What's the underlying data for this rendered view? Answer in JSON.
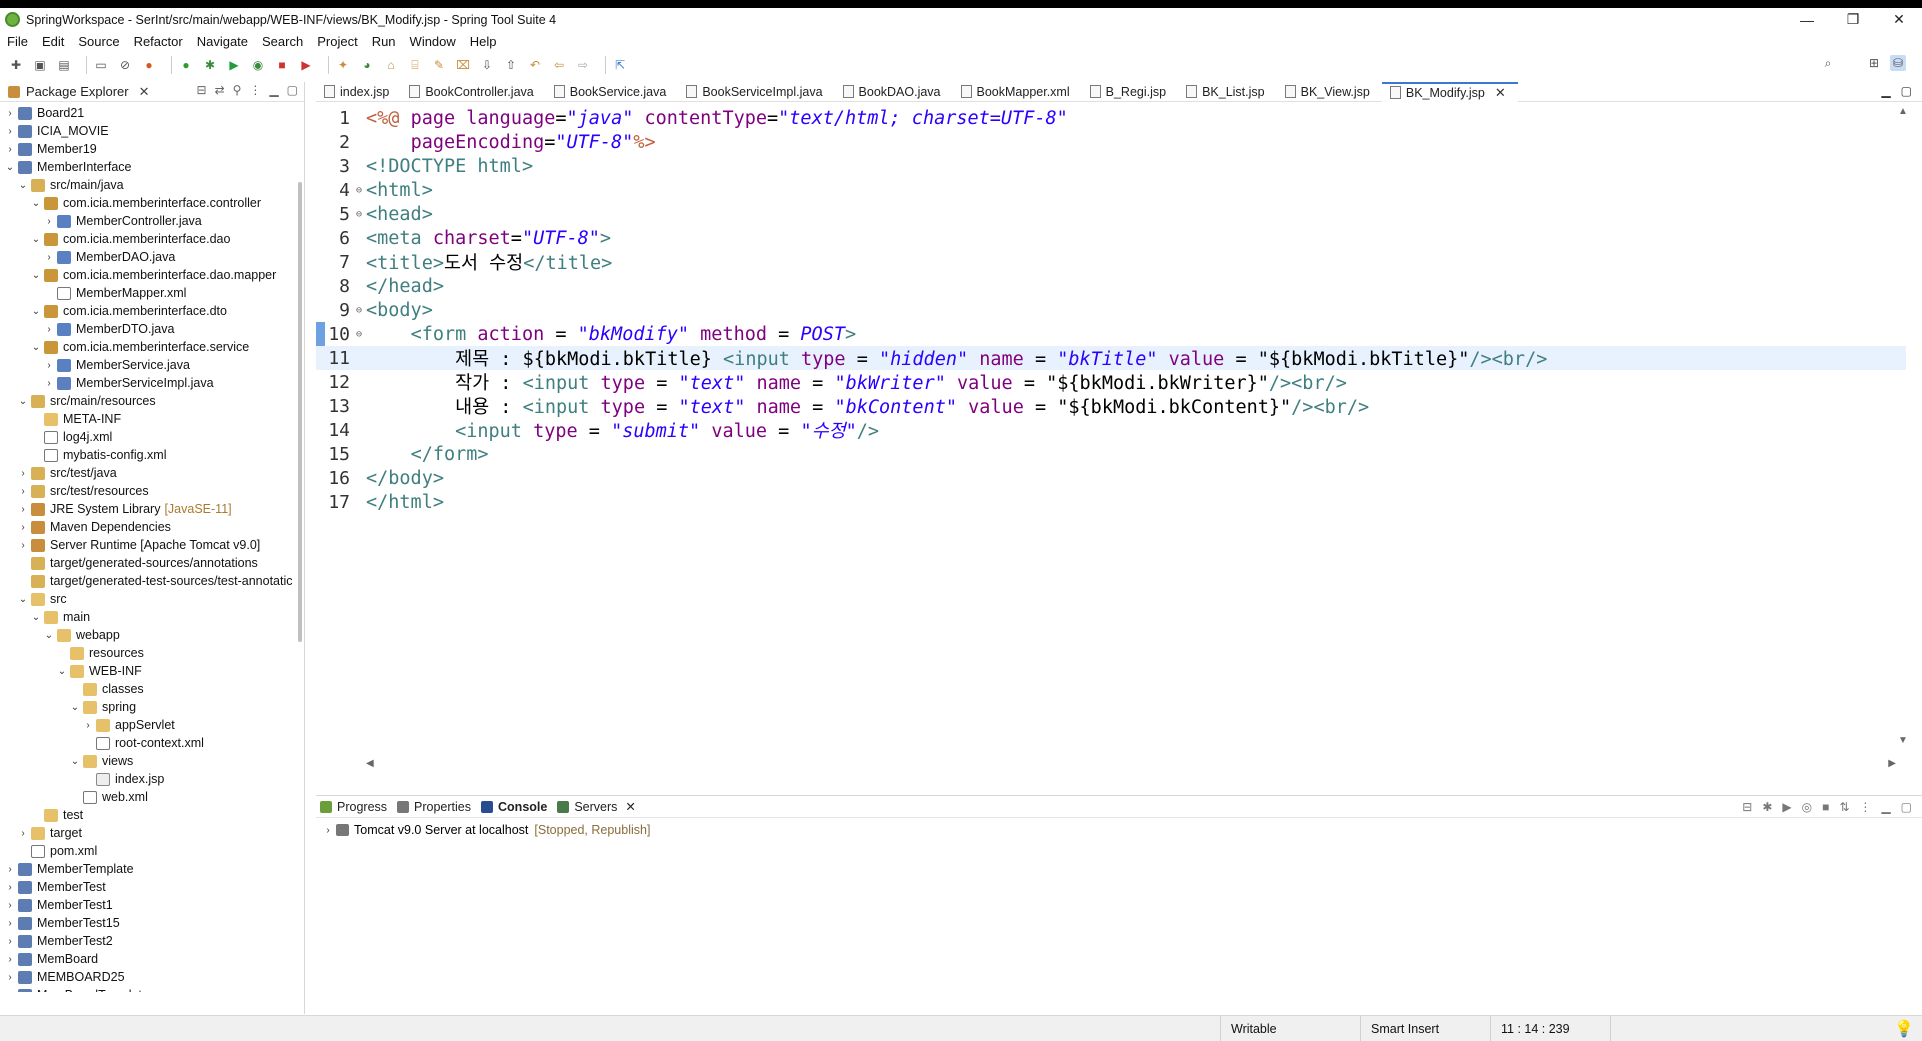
{
  "window": {
    "title": "SpringWorkspace - SerInt/src/main/webapp/WEB-INF/views/BK_Modify.jsp - Spring Tool Suite 4",
    "minimize": "—",
    "restore": "❐",
    "close": "✕"
  },
  "menu": [
    "File",
    "Edit",
    "Source",
    "Refactor",
    "Navigate",
    "Search",
    "Project",
    "Run",
    "Window",
    "Help"
  ],
  "package_explorer": {
    "title": "Package Explorer",
    "tree": [
      {
        "label": "Board21",
        "level": 0,
        "twisty": "›",
        "icon": "proj"
      },
      {
        "label": "ICIA_MOVIE",
        "level": 0,
        "twisty": "›",
        "icon": "proj"
      },
      {
        "label": "Member19",
        "level": 0,
        "twisty": "›",
        "icon": "proj"
      },
      {
        "label": "MemberInterface",
        "level": 0,
        "twisty": "⌄",
        "icon": "proj"
      },
      {
        "label": "src/main/java",
        "level": 1,
        "twisty": "⌄",
        "icon": "srcf"
      },
      {
        "label": "com.icia.memberinterface.controller",
        "level": 2,
        "twisty": "⌄",
        "icon": "pkg"
      },
      {
        "label": "MemberController.java",
        "level": 3,
        "twisty": "›",
        "icon": "java"
      },
      {
        "label": "com.icia.memberinterface.dao",
        "level": 2,
        "twisty": "⌄",
        "icon": "pkg"
      },
      {
        "label": "MemberDAO.java",
        "level": 3,
        "twisty": "›",
        "icon": "java"
      },
      {
        "label": "com.icia.memberinterface.dao.mapper",
        "level": 2,
        "twisty": "⌄",
        "icon": "pkg"
      },
      {
        "label": "MemberMapper.xml",
        "level": 3,
        "twisty": "",
        "icon": "xml"
      },
      {
        "label": "com.icia.memberinterface.dto",
        "level": 2,
        "twisty": "⌄",
        "icon": "pkg"
      },
      {
        "label": "MemberDTO.java",
        "level": 3,
        "twisty": "›",
        "icon": "java"
      },
      {
        "label": "com.icia.memberinterface.service",
        "level": 2,
        "twisty": "⌄",
        "icon": "pkg"
      },
      {
        "label": "MemberService.java",
        "level": 3,
        "twisty": "›",
        "icon": "java"
      },
      {
        "label": "MemberServiceImpl.java",
        "level": 3,
        "twisty": "›",
        "icon": "java"
      },
      {
        "label": "src/main/resources",
        "level": 1,
        "twisty": "⌄",
        "icon": "srcf"
      },
      {
        "label": "META-INF",
        "level": 2,
        "twisty": "",
        "icon": "folder"
      },
      {
        "label": "log4j.xml",
        "level": 2,
        "twisty": "",
        "icon": "xml"
      },
      {
        "label": "mybatis-config.xml",
        "level": 2,
        "twisty": "",
        "icon": "xml"
      },
      {
        "label": "src/test/java",
        "level": 1,
        "twisty": "›",
        "icon": "srcf"
      },
      {
        "label": "src/test/resources",
        "level": 1,
        "twisty": "›",
        "icon": "srcf"
      },
      {
        "label": "JRE System Library",
        "extra": "[JavaSE-11]",
        "level": 1,
        "twisty": "›",
        "icon": "lib"
      },
      {
        "label": "Maven Dependencies",
        "level": 1,
        "twisty": "›",
        "icon": "lib"
      },
      {
        "label": "Server Runtime [Apache Tomcat v9.0]",
        "level": 1,
        "twisty": "›",
        "icon": "lib"
      },
      {
        "label": "target/generated-sources/annotations",
        "level": 1,
        "twisty": "",
        "icon": "srcf"
      },
      {
        "label": "target/generated-test-sources/test-annotatic",
        "level": 1,
        "twisty": "",
        "icon": "srcf"
      },
      {
        "label": "src",
        "level": 1,
        "twisty": "⌄",
        "icon": "folder"
      },
      {
        "label": "main",
        "level": 2,
        "twisty": "⌄",
        "icon": "folder"
      },
      {
        "label": "webapp",
        "level": 3,
        "twisty": "⌄",
        "icon": "folder"
      },
      {
        "label": "resources",
        "level": 4,
        "twisty": "",
        "icon": "folder"
      },
      {
        "label": "WEB-INF",
        "level": 4,
        "twisty": "⌄",
        "icon": "folder"
      },
      {
        "label": "classes",
        "level": 5,
        "twisty": "",
        "icon": "folder"
      },
      {
        "label": "spring",
        "level": 5,
        "twisty": "⌄",
        "icon": "folder"
      },
      {
        "label": "appServlet",
        "level": 6,
        "twisty": "›",
        "icon": "folder"
      },
      {
        "label": "root-context.xml",
        "level": 6,
        "twisty": "",
        "icon": "xml"
      },
      {
        "label": "views",
        "level": 5,
        "twisty": "⌄",
        "icon": "folder"
      },
      {
        "label": "index.jsp",
        "level": 6,
        "twisty": "",
        "icon": "jsp"
      },
      {
        "label": "web.xml",
        "level": 5,
        "twisty": "",
        "icon": "xml"
      },
      {
        "label": "test",
        "level": 2,
        "twisty": "",
        "icon": "folder"
      },
      {
        "label": "target",
        "level": 1,
        "twisty": "›",
        "icon": "folder"
      },
      {
        "label": "pom.xml",
        "level": 1,
        "twisty": "",
        "icon": "xml"
      },
      {
        "label": "MemberTemplate",
        "level": 0,
        "twisty": "›",
        "icon": "proj"
      },
      {
        "label": "MemberTest",
        "level": 0,
        "twisty": "›",
        "icon": "proj"
      },
      {
        "label": "MemberTest1",
        "level": 0,
        "twisty": "›",
        "icon": "proj"
      },
      {
        "label": "MemberTest15",
        "level": 0,
        "twisty": "›",
        "icon": "proj"
      },
      {
        "label": "MemberTest2",
        "level": 0,
        "twisty": "›",
        "icon": "proj"
      },
      {
        "label": "MemBoard",
        "level": 0,
        "twisty": "›",
        "icon": "proj"
      },
      {
        "label": "MEMBOARD25",
        "level": 0,
        "twisty": "›",
        "icon": "proj"
      },
      {
        "label": "MemBoardTemplate",
        "level": 0,
        "twisty": "›",
        "icon": "proj"
      }
    ]
  },
  "editor": {
    "tabs": [
      {
        "label": "index.jsp",
        "active": false
      },
      {
        "label": "BookController.java",
        "active": false
      },
      {
        "label": "BookService.java",
        "active": false
      },
      {
        "label": "BookServiceImpl.java",
        "active": false
      },
      {
        "label": "BookDAO.java",
        "active": false
      },
      {
        "label": "BookMapper.xml",
        "active": false
      },
      {
        "label": "B_Regi.jsp",
        "active": false
      },
      {
        "label": "BK_List.jsp",
        "active": false
      },
      {
        "label": "BK_View.jsp",
        "active": false
      },
      {
        "label": "BK_Modify.jsp",
        "active": true
      }
    ],
    "current_line": 11,
    "lines": [
      {
        "n": "1",
        "fold": "",
        "tokens": [
          [
            "dir",
            "<%@ "
          ],
          [
            "attr",
            "page "
          ],
          [
            "attr",
            "language"
          ],
          [
            "pln",
            "="
          ],
          [
            "str",
            "\"java\""
          ],
          [
            "pln",
            " "
          ],
          [
            "attr",
            "contentType"
          ],
          [
            "pln",
            "="
          ],
          [
            "str",
            "\"text/html; charset=UTF-8\""
          ]
        ]
      },
      {
        "n": "2",
        "fold": "",
        "tokens": [
          [
            "pln",
            "    "
          ],
          [
            "attr",
            "pageEncoding"
          ],
          [
            "pln",
            "="
          ],
          [
            "str",
            "\"UTF-8\""
          ],
          [
            "dir",
            "%>"
          ]
        ]
      },
      {
        "n": "3",
        "fold": "",
        "tokens": [
          [
            "tag",
            "<!DOCTYPE "
          ],
          [
            "tag",
            "html"
          ],
          [
            "tag",
            ">"
          ]
        ]
      },
      {
        "n": "4",
        "fold": "⊖",
        "tokens": [
          [
            "tag",
            "<html>"
          ]
        ]
      },
      {
        "n": "5",
        "fold": "⊖",
        "tokens": [
          [
            "tag",
            "<head>"
          ]
        ]
      },
      {
        "n": "6",
        "fold": "",
        "tokens": [
          [
            "tag",
            "<meta "
          ],
          [
            "attr",
            "charset"
          ],
          [
            "pln",
            "="
          ],
          [
            "str",
            "\"UTF-8\""
          ],
          [
            "tag",
            ">"
          ]
        ]
      },
      {
        "n": "7",
        "fold": "",
        "tokens": [
          [
            "tag",
            "<title>"
          ],
          [
            "pln",
            "도서 수정"
          ],
          [
            "tag",
            "</title>"
          ]
        ]
      },
      {
        "n": "8",
        "fold": "",
        "tokens": [
          [
            "tag",
            "</head>"
          ]
        ]
      },
      {
        "n": "9",
        "fold": "⊖",
        "tokens": [
          [
            "tag",
            "<body>"
          ]
        ]
      },
      {
        "n": "10",
        "fold": "⊖",
        "tokens": [
          [
            "pln",
            "    "
          ],
          [
            "tag",
            "<form "
          ],
          [
            "attr",
            "action"
          ],
          [
            "pln",
            " = "
          ],
          [
            "str",
            "\"bkModify\""
          ],
          [
            "pln",
            " "
          ],
          [
            "attr",
            "method"
          ],
          [
            "pln",
            " = "
          ],
          [
            "str",
            "POST"
          ],
          [
            "tag",
            ">"
          ]
        ]
      },
      {
        "n": "11",
        "fold": "",
        "tokens": [
          [
            "pln",
            "        제목 : ${bkModi.bkTitle} "
          ],
          [
            "tag",
            "<input "
          ],
          [
            "attr",
            "type"
          ],
          [
            "pln",
            " = "
          ],
          [
            "str",
            "\"hidden\""
          ],
          [
            "pln",
            " "
          ],
          [
            "attr",
            "name"
          ],
          [
            "pln",
            " = "
          ],
          [
            "str",
            "\"bkTitle\""
          ],
          [
            "pln",
            " "
          ],
          [
            "attr",
            "value"
          ],
          [
            "pln",
            " = "
          ],
          [
            "pln",
            "\"${bkModi.bkTitle}\""
          ],
          [
            "tag",
            "/><br/>"
          ]
        ]
      },
      {
        "n": "12",
        "fold": "",
        "tokens": [
          [
            "pln",
            "        작가 : "
          ],
          [
            "tag",
            "<input "
          ],
          [
            "attr",
            "type"
          ],
          [
            "pln",
            " = "
          ],
          [
            "str",
            "\"text\""
          ],
          [
            "pln",
            " "
          ],
          [
            "attr",
            "name"
          ],
          [
            "pln",
            " = "
          ],
          [
            "str",
            "\"bkWriter\""
          ],
          [
            "pln",
            " "
          ],
          [
            "attr",
            "value"
          ],
          [
            "pln",
            " = "
          ],
          [
            "pln",
            "\"${bkModi.bkWriter}\""
          ],
          [
            "tag",
            "/><br/>"
          ]
        ]
      },
      {
        "n": "13",
        "fold": "",
        "tokens": [
          [
            "pln",
            "        내용 : "
          ],
          [
            "tag",
            "<input "
          ],
          [
            "attr",
            "type"
          ],
          [
            "pln",
            " = "
          ],
          [
            "str",
            "\"text\""
          ],
          [
            "pln",
            " "
          ],
          [
            "attr",
            "name"
          ],
          [
            "pln",
            " = "
          ],
          [
            "str",
            "\"bkContent\""
          ],
          [
            "pln",
            " "
          ],
          [
            "attr",
            "value"
          ],
          [
            "pln",
            " = "
          ],
          [
            "pln",
            "\"${bkModi.bkContent}\""
          ],
          [
            "tag",
            "/><br/>"
          ]
        ]
      },
      {
        "n": "14",
        "fold": "",
        "tokens": [
          [
            "pln",
            "        "
          ],
          [
            "tag",
            "<input "
          ],
          [
            "attr",
            "type"
          ],
          [
            "pln",
            " = "
          ],
          [
            "str",
            "\"submit\""
          ],
          [
            "pln",
            " "
          ],
          [
            "attr",
            "value"
          ],
          [
            "pln",
            " = "
          ],
          [
            "str",
            "\"수정\""
          ],
          [
            "tag",
            "/>"
          ]
        ]
      },
      {
        "n": "15",
        "fold": "",
        "tokens": [
          [
            "pln",
            "    "
          ],
          [
            "tag",
            "</form>"
          ]
        ]
      },
      {
        "n": "16",
        "fold": "",
        "tokens": [
          [
            "tag",
            "</body>"
          ]
        ]
      },
      {
        "n": "17",
        "fold": "",
        "tokens": [
          [
            "tag",
            "</html>"
          ]
        ]
      }
    ]
  },
  "bottom": {
    "tabs": [
      {
        "label": "Progress",
        "active": false
      },
      {
        "label": "Properties",
        "active": false
      },
      {
        "label": "Console",
        "active": true
      },
      {
        "label": "Servers",
        "active": false
      }
    ],
    "server": {
      "label": "Tomcat v9.0 Server at localhost",
      "status": "[Stopped, Republish]"
    }
  },
  "statusbar": {
    "mode": "Writable",
    "insert": "Smart Insert",
    "position": "11 : 14 : 239"
  },
  "colors": {
    "tag": "#3f7f7f",
    "attr": "#7f007f",
    "string": "#2a00ff",
    "directive": "#bf5f3f",
    "current_line": "#e8f2fe"
  }
}
